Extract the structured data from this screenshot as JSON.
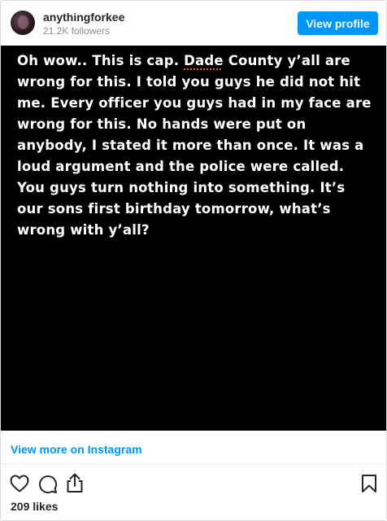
{
  "header": {
    "username": "anythingforkee",
    "followers": "21.2K followers",
    "view_profile_label": "View profile"
  },
  "post": {
    "text_before": "Oh wow.. This is cap. ",
    "text_misspelled": "Dade",
    "text_after": " County y’all are wrong for this. I told you guys he did not hit me. Every officer you guys had in my face are wrong for this. No hands were put on anybody, I stated it more than once. It was a loud argument and the police were called. You guys turn nothing into something. It’s our sons first birthday tomorrow, what’s wrong with y’all?",
    "background_color": "#000000",
    "text_color": "#ffffff"
  },
  "view_more_label": "View more on Instagram",
  "actions": {
    "icons": [
      "heart-icon",
      "comment-icon",
      "share-icon",
      "bookmark-icon"
    ]
  },
  "likes": "209 likes",
  "colors": {
    "accent": "#0095f6",
    "secondary_text": "#8e8e8e"
  }
}
